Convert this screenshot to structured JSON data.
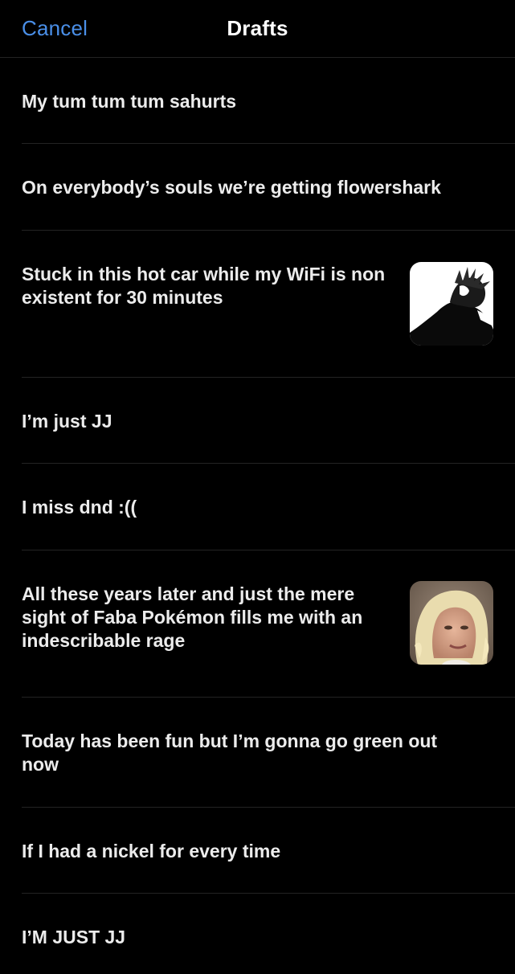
{
  "header": {
    "cancel_label": "Cancel",
    "title": "Drafts"
  },
  "drafts": [
    {
      "text": "My tum tum tum sahurts",
      "has_image": false
    },
    {
      "text": "On everybody’s souls we’re getting flowershark",
      "has_image": false
    },
    {
      "text": "Stuck in this hot car while my WiFi is non existent for 30 minutes",
      "has_image": true,
      "image": "manga-character-thumbnail"
    },
    {
      "text": "I’m just JJ",
      "has_image": false
    },
    {
      "text": "I miss dnd :((",
      "has_image": false
    },
    {
      "text": "All these years later and just the mere sight of Faba Pokémon fills me with an indescribable rage",
      "has_image": true,
      "image": "blonde-woman-photo-thumbnail"
    },
    {
      "text": "Today has been fun but I’m gonna go green out now",
      "has_image": false
    },
    {
      "text": "If I had a nickel for every time",
      "has_image": false
    },
    {
      "text": "I’M JUST JJ",
      "has_image": false
    }
  ],
  "colors": {
    "background": "#000000",
    "accent": "#4a8fe8",
    "text": "#ececec",
    "divider": "#232323"
  }
}
